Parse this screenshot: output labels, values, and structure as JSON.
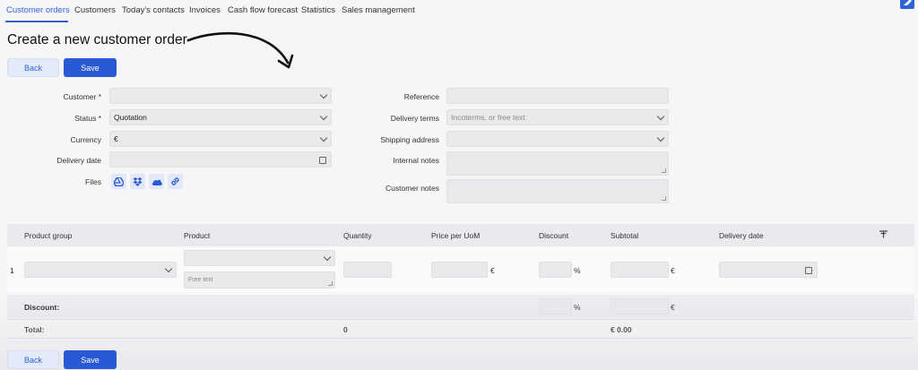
{
  "nav": {
    "items": [
      "Customer orders",
      "Customers",
      "Today's contacts",
      "Invoices",
      "Cash flow forecast",
      "Statistics",
      "Sales management"
    ]
  },
  "page_title": "Create a new customer order",
  "buttons": {
    "back": "Back",
    "save": "Save"
  },
  "form_left": {
    "customer_label": "Customer *",
    "customer_value": "",
    "status_label": "Status *",
    "status_value": "Quotation",
    "currency_label": "Currency",
    "currency_value": "€",
    "delivery_date_label": "Delivery date",
    "delivery_date_value": "",
    "files_label": "Files",
    "file_icons": [
      "google-drive-icon",
      "dropbox-icon",
      "onedrive-icon",
      "link-icon"
    ]
  },
  "form_right": {
    "reference_label": "Reference",
    "delivery_terms_label": "Delivery terms",
    "delivery_terms_placeholder": "Incoterms, or free text",
    "shipping_address_label": "Shipping address",
    "internal_notes_label": "Internal notes",
    "customer_notes_label": "Customer notes"
  },
  "table": {
    "columns": [
      "Product group",
      "Product",
      "Quantity",
      "Price per UoM",
      "Discount",
      "Subtotal",
      "Delivery date"
    ],
    "row_number": "1",
    "free_text_placeholder": "Free text",
    "currency_unit": "€",
    "percent_unit": "%"
  },
  "summary": {
    "discount_label": "Discount:",
    "total_label": "Total:",
    "total_quantity": "0",
    "total_amount": "€ 0.00"
  },
  "colors": {
    "accent": "#2a59d6",
    "field_bg": "#e9e9ec"
  }
}
